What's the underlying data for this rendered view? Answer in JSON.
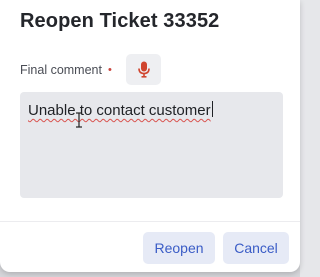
{
  "dialog": {
    "title": "Reopen Ticket 33352"
  },
  "comment_field": {
    "label": "Final comment",
    "required_marker": "•",
    "value": "Unable to contact customer",
    "mic_icon": "microphone-icon"
  },
  "actions": {
    "reopen_label": "Reopen",
    "cancel_label": "Cancel"
  },
  "colors": {
    "accent": "#3a5cc6",
    "button_bg": "#e6eaf6",
    "required": "#c9443c",
    "mic": "#d0452f",
    "field_bg": "#e7e8ec"
  }
}
